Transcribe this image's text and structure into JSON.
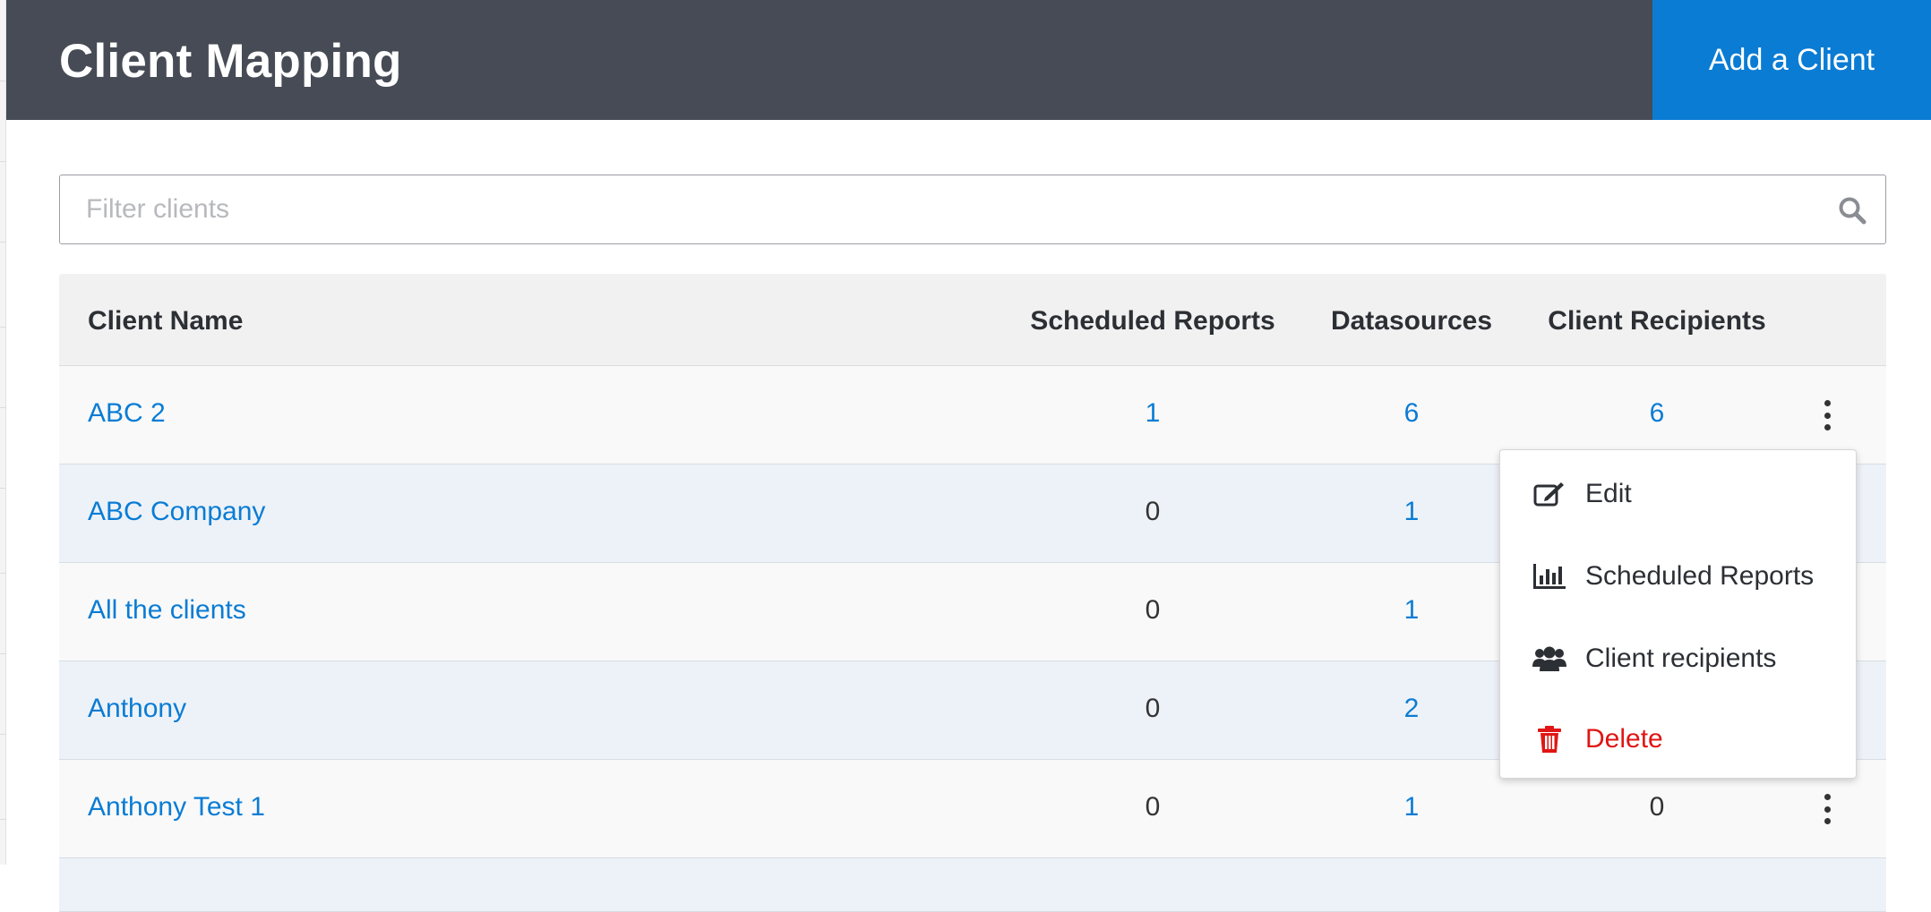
{
  "header": {
    "title": "Client Mapping",
    "add_button_label": "Add a Client"
  },
  "filter": {
    "placeholder": "Filter clients",
    "value": ""
  },
  "table": {
    "columns": {
      "client_name": "Client Name",
      "scheduled_reports": "Scheduled Reports",
      "datasources": "Datasources",
      "client_recipients": "Client Recipients"
    },
    "rows": [
      {
        "name": "ABC 2",
        "scheduled_reports": "1",
        "datasources": "6",
        "client_recipients": "6"
      },
      {
        "name": "ABC Company",
        "scheduled_reports": "0",
        "datasources": "1",
        "client_recipients": ""
      },
      {
        "name": "All the clients",
        "scheduled_reports": "0",
        "datasources": "1",
        "client_recipients": ""
      },
      {
        "name": "Anthony",
        "scheduled_reports": "0",
        "datasources": "2",
        "client_recipients": ""
      },
      {
        "name": "Anthony Test 1",
        "scheduled_reports": "0",
        "datasources": "1",
        "client_recipients": "0"
      }
    ]
  },
  "context_menu": {
    "items": [
      {
        "label": "Edit",
        "icon": "edit-icon"
      },
      {
        "label": "Scheduled Reports",
        "icon": "bar-chart-icon"
      },
      {
        "label": "Client recipients",
        "icon": "users-icon"
      },
      {
        "label": "Delete",
        "icon": "trash-icon"
      }
    ]
  },
  "colors": {
    "header_bg": "#464b55",
    "accent": "#0a7cd4",
    "danger": "#e01515"
  }
}
